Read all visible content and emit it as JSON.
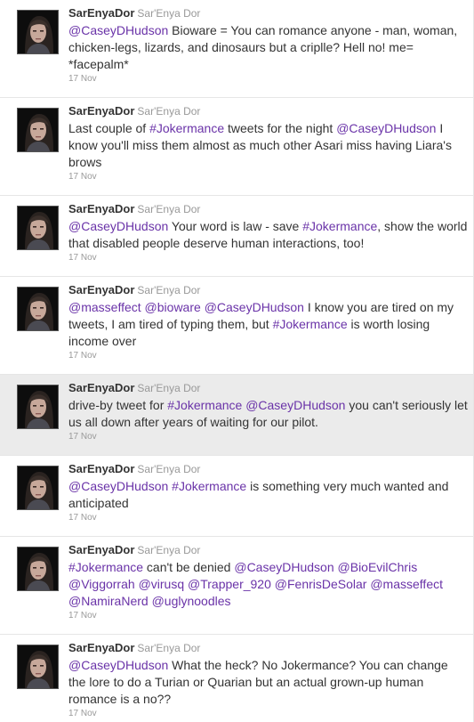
{
  "tweets": [
    {
      "username": "SarEnyaDor",
      "fullname": "Sar'Enya Dor",
      "time": "17 Nov",
      "highlighted": false,
      "segments": [
        {
          "t": "@CaseyDHudson",
          "k": "mention"
        },
        {
          "t": " Bioware = You can romance anyone - man, woman, chicken-legs, lizards, and dinosaurs but a criplle? Hell no! me= *facepalm*",
          "k": "text"
        }
      ]
    },
    {
      "username": "SarEnyaDor",
      "fullname": "Sar'Enya Dor",
      "time": "17 Nov",
      "highlighted": false,
      "segments": [
        {
          "t": "Last couple of ",
          "k": "text"
        },
        {
          "t": "#Jokermance",
          "k": "hashtag"
        },
        {
          "t": " tweets for the night ",
          "k": "text"
        },
        {
          "t": "@CaseyDHudson",
          "k": "mention"
        },
        {
          "t": " I know you'll miss them almost as much other Asari miss having Liara's brows",
          "k": "text"
        }
      ]
    },
    {
      "username": "SarEnyaDor",
      "fullname": "Sar'Enya Dor",
      "time": "17 Nov",
      "highlighted": false,
      "segments": [
        {
          "t": "@CaseyDHudson",
          "k": "mention"
        },
        {
          "t": " Your word is law - save ",
          "k": "text"
        },
        {
          "t": "#Jokermance",
          "k": "hashtag"
        },
        {
          "t": ", show the world that disabled people deserve human interactions, too!",
          "k": "text"
        }
      ]
    },
    {
      "username": "SarEnyaDor",
      "fullname": "Sar'Enya Dor",
      "time": "17 Nov",
      "highlighted": false,
      "segments": [
        {
          "t": "@masseffect",
          "k": "mention"
        },
        {
          "t": " ",
          "k": "text"
        },
        {
          "t": "@bioware",
          "k": "mention"
        },
        {
          "t": " ",
          "k": "text"
        },
        {
          "t": "@CaseyDHudson",
          "k": "mention"
        },
        {
          "t": " I know you are tired on my tweets, I am tired of typing them, but ",
          "k": "text"
        },
        {
          "t": "#Jokermance",
          "k": "hashtag"
        },
        {
          "t": " is worth losing income over",
          "k": "text"
        }
      ]
    },
    {
      "username": "SarEnyaDor",
      "fullname": "Sar'Enya Dor",
      "time": "17 Nov",
      "highlighted": true,
      "segments": [
        {
          "t": "drive-by tweet for ",
          "k": "text"
        },
        {
          "t": "#Jokermance",
          "k": "hashtag"
        },
        {
          "t": " ",
          "k": "text"
        },
        {
          "t": "@CaseyDHudson",
          "k": "mention"
        },
        {
          "t": " you can't seriously let us all down after years of waiting for our pilot.",
          "k": "text"
        }
      ]
    },
    {
      "username": "SarEnyaDor",
      "fullname": "Sar'Enya Dor",
      "time": "17 Nov",
      "highlighted": false,
      "segments": [
        {
          "t": "@CaseyDHudson",
          "k": "mention"
        },
        {
          "t": " ",
          "k": "text"
        },
        {
          "t": "#Jokermance",
          "k": "hashtag"
        },
        {
          "t": " is something very much wanted and anticipated",
          "k": "text"
        }
      ]
    },
    {
      "username": "SarEnyaDor",
      "fullname": "Sar'Enya Dor",
      "time": "17 Nov",
      "highlighted": false,
      "segments": [
        {
          "t": "#Jokermance",
          "k": "hashtag"
        },
        {
          "t": " can't be denied ",
          "k": "text"
        },
        {
          "t": "@CaseyDHudson",
          "k": "mention"
        },
        {
          "t": " ",
          "k": "text"
        },
        {
          "t": "@BioEvilChris",
          "k": "mention"
        },
        {
          "t": " ",
          "k": "text"
        },
        {
          "t": "@Viggorrah",
          "k": "mention"
        },
        {
          "t": " ",
          "k": "text"
        },
        {
          "t": "@virusq",
          "k": "mention"
        },
        {
          "t": " ",
          "k": "text"
        },
        {
          "t": "@Trapper_920",
          "k": "mention"
        },
        {
          "t": " ",
          "k": "text"
        },
        {
          "t": "@FenrisDeSolar",
          "k": "mention"
        },
        {
          "t": " ",
          "k": "text"
        },
        {
          "t": "@masseffect",
          "k": "mention"
        },
        {
          "t": " ",
          "k": "text"
        },
        {
          "t": "@NamiraNerd",
          "k": "mention"
        },
        {
          "t": " ",
          "k": "text"
        },
        {
          "t": "@uglynoodles",
          "k": "mention"
        }
      ]
    },
    {
      "username": "SarEnyaDor",
      "fullname": "Sar'Enya Dor",
      "time": "17 Nov",
      "highlighted": false,
      "segments": [
        {
          "t": "@CaseyDHudson",
          "k": "mention"
        },
        {
          "t": " What the heck? No Jokermance? You can change the lore to do a Turian or Quarian but an actual grown-up human romance is a no??",
          "k": "text"
        }
      ]
    }
  ],
  "colors": {
    "link": "#6a33a8",
    "username": "#333333",
    "meta": "#999999",
    "highlight_bg": "#ebebeb",
    "divider": "#e6e6e6"
  },
  "icons": {
    "avatar": "profile-photo"
  }
}
